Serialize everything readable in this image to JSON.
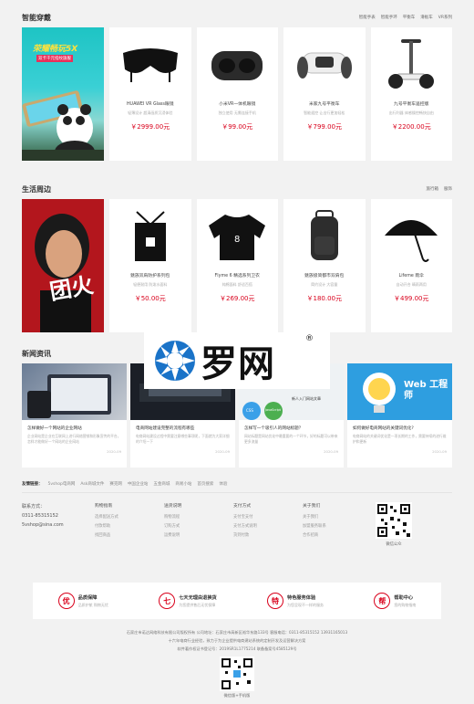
{
  "wearables": {
    "title": "智能穿戴",
    "links": [
      "智能手表",
      "智能手环",
      "平衡车",
      "滑板车",
      "VR系列"
    ],
    "banner": {
      "headline": "荣耀畅玩5X",
      "sub": "双卡千元指纹旗舰"
    },
    "products": [
      {
        "name": "HUAWEI VR Glass眼镜",
        "desc": "轻薄设计 超清画质沉浸体验",
        "price": "￥2999.00元"
      },
      {
        "name": "小米VR一体机眼镜",
        "desc": "独立使用 无需连接手机",
        "price": "￥99.00元"
      },
      {
        "name": "米家九号平衡车",
        "desc": "智能遥控 让出行更加轻松",
        "price": "￥799.00元"
      },
      {
        "name": "九号平衡车遥控版",
        "desc": "出行利器 体感操控畅快自由",
        "price": "￥2200.00元"
      }
    ]
  },
  "life": {
    "title": "生活周边",
    "links": [
      "旅行箱",
      "服饰"
    ],
    "banner": {
      "headline": "团火"
    },
    "products": [
      {
        "name": "魅族双肩防护系列包",
        "desc": "轻便耐用 防泼水面料",
        "price": "￥50.00元"
      },
      {
        "name": "Flyme 6 精选系列卫衣",
        "desc": "纯棉面料 舒适百搭",
        "price": "￥269.00元"
      },
      {
        "name": "魅族极简都市双肩包",
        "desc": "简约设计 大容量",
        "price": "￥180.00元"
      },
      {
        "name": "Lifeme 雨伞",
        "desc": "自动开合 晴雨两用",
        "price": "￥499.00元"
      }
    ]
  },
  "news": {
    "title": "新闻资讯",
    "items": [
      {
        "title": "怎样做好一个网站的企业网站",
        "desc": "企业网站是企业在互联网上进行网络营销和形象宣传的平台，怎样才能做好一个网站的企业网站",
        "date": "2020-09"
      },
      {
        "title": "电商网站建设完整的流程有哪些",
        "desc": "电商网站建设过程中需要注意哪些事项呢，下面就为大家详细的介绍一下",
        "date": "2020-09"
      },
      {
        "title": "怎样写一个吸引人的网站标题？",
        "desc": "网站标题是网站优化中最重要的一个环节，好的标题可以带来更多流量",
        "date": "2020-09"
      },
      {
        "title": "如何做好电商网站的关键词优化?",
        "desc": "电商网站的关键词优化是一项长期的工作，需要持续的进行维护和更新",
        "date": "2020-09"
      }
    ],
    "card3_caption": "新人入门网站文章",
    "card4_caption": "Web 工程师",
    "css_label": "CSS",
    "js_label": "JavaScript"
  },
  "friend_links": {
    "label": "友情链接：",
    "items": [
      "5vshop电商网",
      "Ask商城文件",
      "赛克网",
      "中国企业站",
      "五金商城",
      "商易小站",
      "首页搜索",
      "体验"
    ]
  },
  "footer": {
    "contact_title": "联系方式：",
    "phone": "0311-85315152",
    "email": "5vshop@sina.com",
    "columns": [
      {
        "title": "购物指南",
        "items": [
          "选择配送方式",
          "付款帮助",
          "找回商品"
        ]
      },
      {
        "title": "送货说明",
        "items": [
          "购物流程",
          "订购方式",
          "运费说明"
        ]
      },
      {
        "title": "支付方式",
        "items": [
          "支付宝支付",
          "支付方式说明",
          "货到付款"
        ]
      },
      {
        "title": "关于我们",
        "items": [
          "关于我们",
          "加盟服务联系",
          "合作招商"
        ]
      }
    ],
    "qr_caption": "微信公众"
  },
  "services": [
    {
      "icon": "优",
      "title": "品质保障",
      "sub": "品质护航 购物无忧"
    },
    {
      "icon": "七",
      "title": "七天无理由退换货",
      "sub": "为您提供售后无忧保障"
    },
    {
      "icon": "特",
      "title": "特色服务体验",
      "sub": "为您呈现不一样的服务"
    },
    {
      "icon": "帮",
      "title": "帮助中心",
      "sub": "您的购物指南"
    }
  ],
  "copyright": [
    "石家庄市诺达网络科技有限公司版权所有 公司地址：石家庄市高新区裕华东路133号 客服电话：0311-85315152 13931165013",
    "十六年电商行业经验，致力于为企业提供电商建站系统的定制开发及运营解决方案",
    "软件著作权证书登记号：2019SR1L1775214 联备备案号4585129号"
  ],
  "bottom_qr_caption": "微信版+手机版",
  "watermark": {
    "text": "罗网",
    "reg": "®"
  },
  "colors": {
    "accent": "#d9001b",
    "page_bg": "#f2f2f2",
    "watermark_blue": "#1a73c8"
  }
}
